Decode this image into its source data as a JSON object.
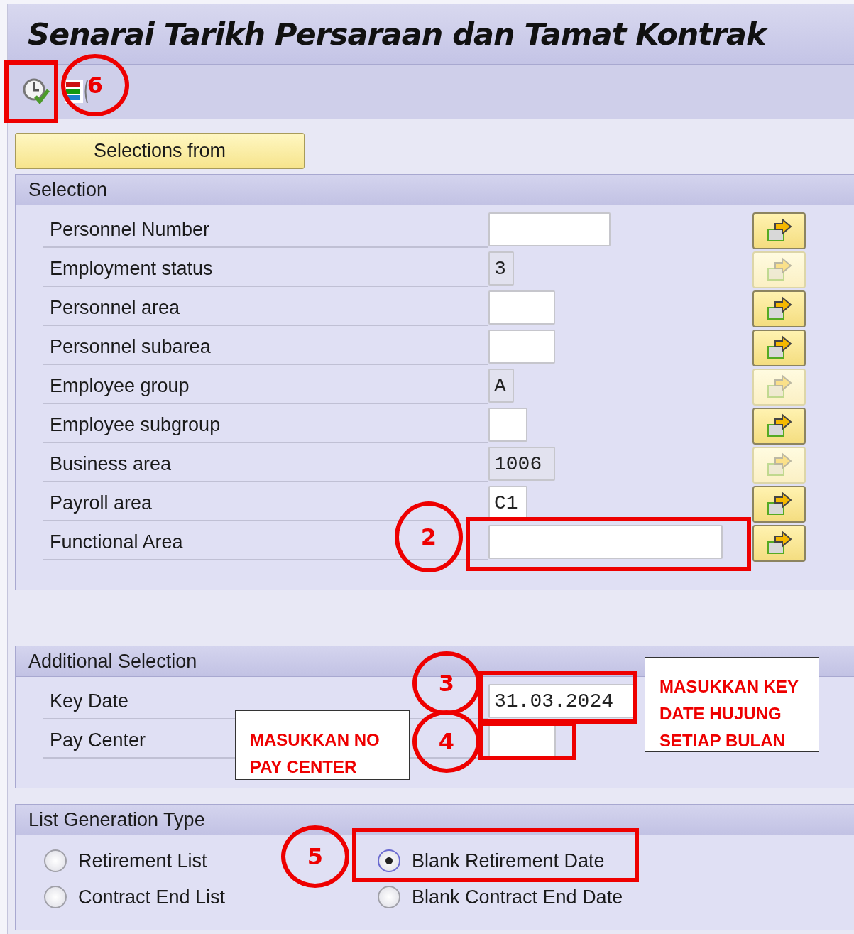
{
  "title": "Senarai Tarikh Persaraan dan Tamat Kontrak",
  "toolbar": [
    {
      "kind": "execute"
    },
    {
      "kind": "layout"
    }
  ],
  "selections_button": "Selections from",
  "selection": {
    "title": "Selection",
    "rows": [
      {
        "label": "Personnel Number",
        "value": "",
        "editable": true,
        "multi_enabled": true
      },
      {
        "label": "Employment status",
        "value": "3",
        "editable": false,
        "multi_enabled": false
      },
      {
        "label": "Personnel area",
        "value": "",
        "editable": true,
        "multi_enabled": true
      },
      {
        "label": "Personnel subarea",
        "value": "",
        "editable": true,
        "multi_enabled": true
      },
      {
        "label": "Employee group",
        "value": "A",
        "editable": false,
        "multi_enabled": false
      },
      {
        "label": "Employee subgroup",
        "value": "",
        "editable": true,
        "multi_enabled": true
      },
      {
        "label": "Business area",
        "value": "1006",
        "editable": false,
        "multi_enabled": false
      },
      {
        "label": "Payroll area",
        "value": "C1",
        "editable": true,
        "multi_enabled": true
      },
      {
        "label": "Functional Area",
        "value": "",
        "editable": true,
        "multi_enabled": true
      }
    ]
  },
  "additional_selection": {
    "title": "Additional Selection",
    "rows": [
      {
        "label": "Key Date",
        "value": "31.03.2024",
        "editable": true
      },
      {
        "label": "Pay Center",
        "value": "",
        "editable": true
      }
    ]
  },
  "list_generation_type": {
    "title": "List Generation Type",
    "options": [
      {
        "label": "Retirement List",
        "selected": false
      },
      {
        "label": "Blank Retirement Date",
        "selected": true
      },
      {
        "label": "Contract End List",
        "selected": false
      },
      {
        "label": "Blank Contract End Date",
        "selected": false
      }
    ]
  },
  "annotations": [
    {
      "kind": "rect"
    },
    {
      "kind": "circle",
      "label": "6"
    },
    {
      "kind": "circle",
      "label": "2"
    },
    {
      "kind": "rect"
    },
    {
      "kind": "circle",
      "label": "3"
    },
    {
      "kind": "rect"
    },
    {
      "kind": "callout",
      "text": "MASUKKAN KEY DATE HUJUNG SETIAP BULAN"
    },
    {
      "kind": "callout",
      "text": "MASUKKAN NO PAY CENTER"
    },
    {
      "kind": "circle",
      "label": "4"
    },
    {
      "kind": "rect"
    },
    {
      "kind": "circle",
      "label": "5"
    },
    {
      "kind": "rect"
    }
  ]
}
